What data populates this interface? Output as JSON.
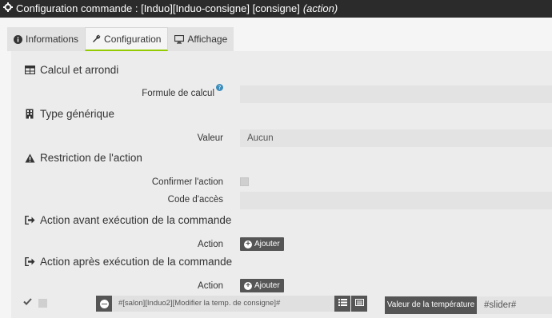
{
  "window": {
    "title_main": "Configuration commande : [Induo][Induo-consigne] [consigne]",
    "title_type": "(action)"
  },
  "tabs": [
    {
      "label": "Informations",
      "icon": "info-circle-icon"
    },
    {
      "label": "Configuration",
      "icon": "wrench-icon",
      "active": true
    },
    {
      "label": "Affichage",
      "icon": "monitor-icon"
    }
  ],
  "sections": {
    "calcul": {
      "title": "Calcul et arrondi",
      "formula_label": "Formule de calcul",
      "formula_value": "",
      "help_icon": "question-circle-icon"
    },
    "generic": {
      "title": "Type générique",
      "value_label": "Valeur",
      "value_selected": "Aucun"
    },
    "restriction": {
      "title": "Restriction de l'action",
      "confirm_label": "Confirmer l'action",
      "confirm_checked": false,
      "code_label": "Code d'accès",
      "code_value": ""
    },
    "pre_action": {
      "title": "Action avant exécution de la commande",
      "action_label": "Action",
      "add_label": "Ajouter"
    },
    "post_action": {
      "title": "Action après exécution de la commande",
      "action_label": "Action",
      "add_label": "Ajouter",
      "row": {
        "enabled": true,
        "command": "#[salon][Induo2][Modifier la temp. de consigne]#",
        "option_label": "Valeur de la température",
        "option_value": "#slider#"
      }
    }
  },
  "colors": {
    "accent": "#94ca02",
    "titlebar": "#2b2b2b",
    "button": "#555555"
  }
}
